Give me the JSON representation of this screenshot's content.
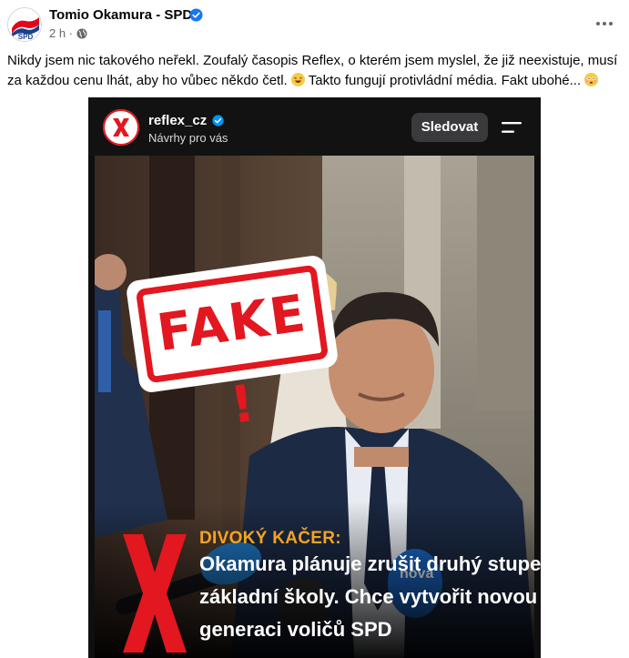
{
  "post": {
    "author": "Tomio Okamura - SPD",
    "time": "2 h ·",
    "text": "Nikdy jsem nic takového neřekl. Zoufalý časopis Reflex, o kterém jsem myslel, že již neexistuje, musí za každou cenu lhát, aby ho vůbec někdo četl.",
    "text2": "Takto fungují protivládní média. Fakt ubohé...",
    "avatar_badge": "SPD"
  },
  "embedded": {
    "account": "reflex_cz",
    "subtitle": "Návrhy pro vás",
    "follow_label": "Sledovat",
    "stamp_text": "FAKE !",
    "caption_label": "DIVOKÝ KAČER:",
    "caption_lines": [
      "Okamura plánuje zrušit druhý stupeň",
      "základní školy. Chce vytvořit novou",
      "generaci voličů SPD"
    ],
    "mic_logo": "nova"
  },
  "colors": {
    "verified": "#1877f2",
    "stamp_red": "#e2171f",
    "caption_orange": "#f4a425",
    "spd_blue": "#1b3f8e",
    "spd_red": "#e3061a"
  },
  "icons": [
    "verified-icon",
    "globe-icon",
    "more-icon",
    "menu-icon",
    "x-logo-icon"
  ]
}
